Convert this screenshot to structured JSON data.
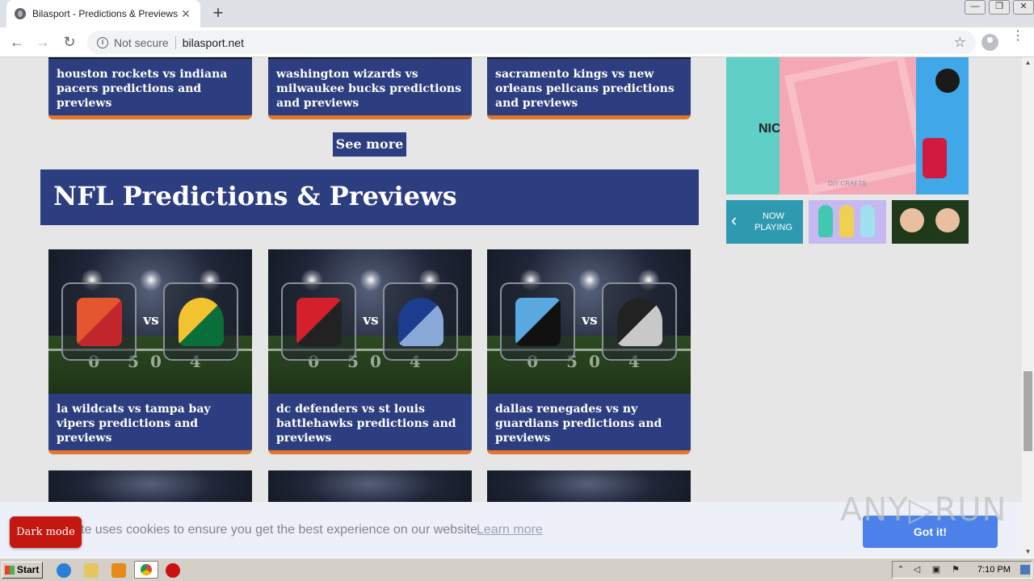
{
  "browser": {
    "tab_title": "Bilasport - Predictions & Previews",
    "tab_close": "✕",
    "new_tab": "+",
    "back": "←",
    "forward": "→",
    "reload": "↻",
    "security_label": "Not secure",
    "url": "bilasport.net",
    "bookmark": "☆",
    "menu": "⋮",
    "window_controls": [
      "—",
      "❐",
      "✕"
    ]
  },
  "nba_cards": [
    {
      "title": "houston rockets vs indiana pacers predictions and previews"
    },
    {
      "title": "washington wizards vs milwaukee bucks predictions and previews"
    },
    {
      "title": "sacramento kings vs new orleans pelicans predictions and previews"
    }
  ],
  "see_more_label": "See more",
  "section_title": "NFL Predictions & Previews",
  "vs_label": "vs",
  "yard_markers": "0 50 4",
  "nfl_cards": [
    {
      "title": "la wildcats vs tampa bay vipers predictions and previews",
      "left_colors": [
        "#e4572e",
        "#c2272d"
      ],
      "right_colors": [
        "#f2c230",
        "#0a6e3a"
      ]
    },
    {
      "title": "dc defenders vs st louis battlehawks predictions and previews",
      "left_colors": [
        "#d3202a",
        "#222"
      ],
      "right_colors": [
        "#1c3d8f",
        "#8aa8d8"
      ]
    },
    {
      "title": "dallas renegades vs ny guardians predictions and previews",
      "left_colors": [
        "#5aa8e0",
        "#111"
      ],
      "right_colors": [
        "#222",
        "#c8c8c8"
      ]
    }
  ],
  "video_widget": {
    "book_text": "NIC",
    "credit": "DIY CRAFTS",
    "now_playing": "NOW PLAYING"
  },
  "cookie": {
    "text": "te uses cookies to ensure you get the best experience on our website.",
    "learn_more": "Learn more",
    "accept": "Got it!"
  },
  "dark_mode_label": "Dark mode",
  "watermark": "ANY▷RUN",
  "taskbar": {
    "start": "Start",
    "clock": "7:10 PM"
  },
  "colors": {
    "primary": "#2c3e80",
    "accent": "#e2762a",
    "cookie_button": "#4b81e8",
    "dark_mode": "#c4170f"
  }
}
